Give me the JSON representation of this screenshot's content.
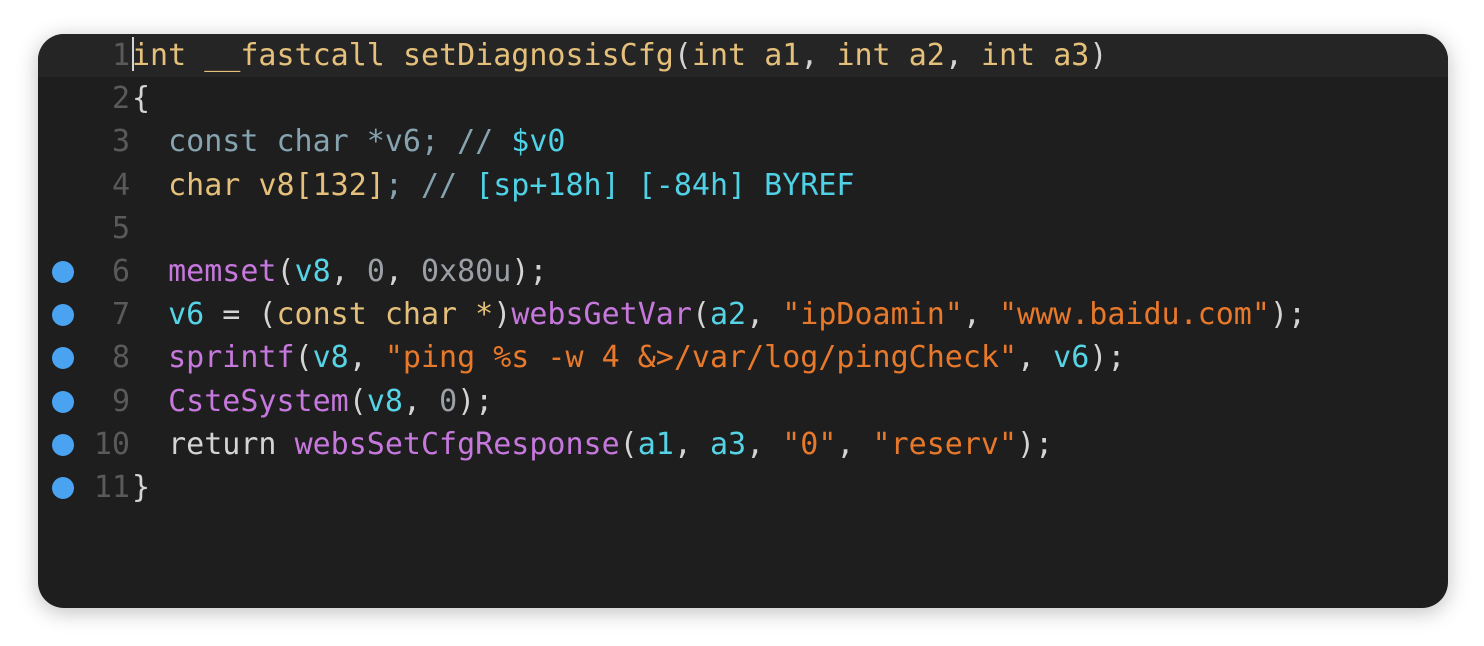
{
  "colors": {
    "background": "#1e1e1e",
    "line_number": "#5a5a5a",
    "breakpoint": "#4aa3f0",
    "keyword": "#e5c07b",
    "function": "#c678dd",
    "variable": "#56d4e6",
    "string": "#e8792b",
    "plain": "#d4d4d4"
  },
  "editor": {
    "lines": [
      {
        "number": "1",
        "breakpoint": false,
        "tokens": [
          {
            "t": "int",
            "c": "kw"
          },
          {
            "t": " ",
            "c": "punc"
          },
          {
            "t": "__fastcall",
            "c": "kw"
          },
          {
            "t": " ",
            "c": "punc"
          },
          {
            "t": "setDiagnosisCfg",
            "c": "kw"
          },
          {
            "t": "(",
            "c": "punc"
          },
          {
            "t": "int",
            "c": "kw"
          },
          {
            "t": " ",
            "c": "punc"
          },
          {
            "t": "a1",
            "c": "kw"
          },
          {
            "t": ", ",
            "c": "punc"
          },
          {
            "t": "int",
            "c": "kw"
          },
          {
            "t": " ",
            "c": "punc"
          },
          {
            "t": "a2",
            "c": "kw"
          },
          {
            "t": ", ",
            "c": "punc"
          },
          {
            "t": "int",
            "c": "kw"
          },
          {
            "t": " ",
            "c": "punc"
          },
          {
            "t": "a3",
            "c": "kw"
          },
          {
            "t": ")",
            "c": "punc"
          }
        ]
      },
      {
        "number": "2",
        "breakpoint": false,
        "tokens": [
          {
            "t": "{",
            "c": "punc"
          }
        ]
      },
      {
        "number": "3",
        "breakpoint": false,
        "tokens": [
          {
            "t": "  ",
            "c": "punc"
          },
          {
            "t": "const char *v6; // ",
            "c": "dim"
          },
          {
            "t": "$v0",
            "c": "cmtname"
          }
        ]
      },
      {
        "number": "4",
        "breakpoint": false,
        "tokens": [
          {
            "t": "  ",
            "c": "punc"
          },
          {
            "t": "char",
            "c": "kw"
          },
          {
            "t": " ",
            "c": "punc"
          },
          {
            "t": "v8",
            "c": "kw"
          },
          {
            "t": "[132]",
            "c": "kw"
          },
          {
            "t": "; // ",
            "c": "dim"
          },
          {
            "t": "[sp+18h] [-84h] BYREF",
            "c": "cmtname"
          }
        ]
      },
      {
        "number": "5",
        "breakpoint": false,
        "tokens": []
      },
      {
        "number": "6",
        "breakpoint": true,
        "tokens": [
          {
            "t": "  ",
            "c": "punc"
          },
          {
            "t": "memset",
            "c": "fn"
          },
          {
            "t": "(",
            "c": "punc"
          },
          {
            "t": "v8",
            "c": "var"
          },
          {
            "t": ", ",
            "c": "punc"
          },
          {
            "t": "0",
            "c": "num"
          },
          {
            "t": ", ",
            "c": "punc"
          },
          {
            "t": "0x80u",
            "c": "num"
          },
          {
            "t": ");",
            "c": "punc"
          }
        ]
      },
      {
        "number": "7",
        "breakpoint": true,
        "tokens": [
          {
            "t": "  ",
            "c": "punc"
          },
          {
            "t": "v6",
            "c": "var"
          },
          {
            "t": " = (",
            "c": "punc"
          },
          {
            "t": "const char *",
            "c": "kw"
          },
          {
            "t": ")",
            "c": "punc"
          },
          {
            "t": "websGetVar",
            "c": "fn"
          },
          {
            "t": "(",
            "c": "punc"
          },
          {
            "t": "a2",
            "c": "var"
          },
          {
            "t": ", ",
            "c": "punc"
          },
          {
            "t": "\"ipDoamin\"",
            "c": "str"
          },
          {
            "t": ", ",
            "c": "punc"
          },
          {
            "t": "\"www.baidu.com\"",
            "c": "str"
          },
          {
            "t": ");",
            "c": "punc"
          }
        ]
      },
      {
        "number": "8",
        "breakpoint": true,
        "tokens": [
          {
            "t": "  ",
            "c": "punc"
          },
          {
            "t": "sprintf",
            "c": "fn"
          },
          {
            "t": "(",
            "c": "punc"
          },
          {
            "t": "v8",
            "c": "var"
          },
          {
            "t": ", ",
            "c": "punc"
          },
          {
            "t": "\"ping %s -w 4 &>/var/log/pingCheck\"",
            "c": "str"
          },
          {
            "t": ", ",
            "c": "punc"
          },
          {
            "t": "v6",
            "c": "var"
          },
          {
            "t": ");",
            "c": "punc"
          }
        ]
      },
      {
        "number": "9",
        "breakpoint": true,
        "tokens": [
          {
            "t": "  ",
            "c": "punc"
          },
          {
            "t": "CsteSystem",
            "c": "fn"
          },
          {
            "t": "(",
            "c": "punc"
          },
          {
            "t": "v8",
            "c": "var"
          },
          {
            "t": ", ",
            "c": "punc"
          },
          {
            "t": "0",
            "c": "num"
          },
          {
            "t": ");",
            "c": "punc"
          }
        ]
      },
      {
        "number": "10",
        "breakpoint": true,
        "tokens": [
          {
            "t": "  ",
            "c": "punc"
          },
          {
            "t": "return",
            "c": "punc"
          },
          {
            "t": " ",
            "c": "punc"
          },
          {
            "t": "websSetCfgResponse",
            "c": "fn"
          },
          {
            "t": "(",
            "c": "punc"
          },
          {
            "t": "a1",
            "c": "var"
          },
          {
            "t": ", ",
            "c": "punc"
          },
          {
            "t": "a3",
            "c": "var"
          },
          {
            "t": ", ",
            "c": "punc"
          },
          {
            "t": "\"0\"",
            "c": "str"
          },
          {
            "t": ", ",
            "c": "punc"
          },
          {
            "t": "\"reserv\"",
            "c": "str"
          },
          {
            "t": ");",
            "c": "punc"
          }
        ]
      },
      {
        "number": "11",
        "breakpoint": true,
        "tokens": [
          {
            "t": "}",
            "c": "punc"
          }
        ]
      }
    ]
  }
}
